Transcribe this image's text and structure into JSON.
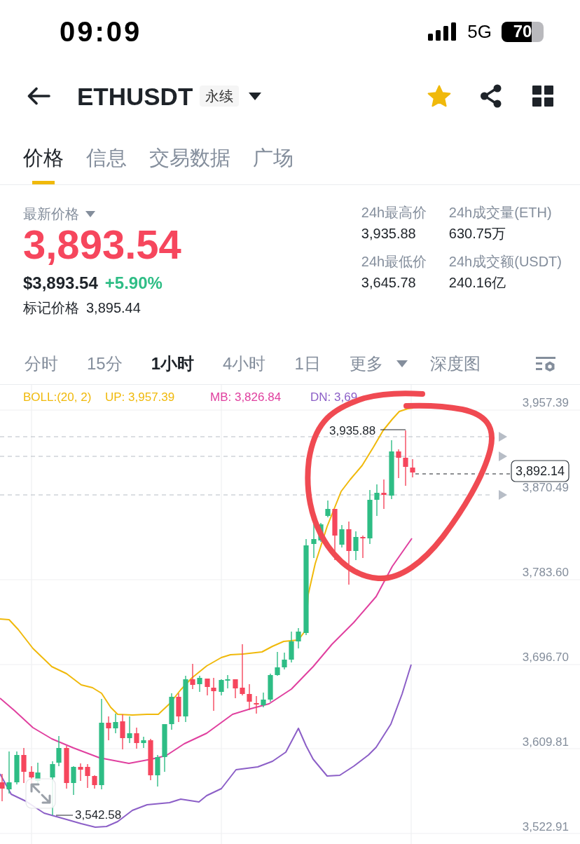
{
  "status_bar": {
    "time": "09:09",
    "network": "5G",
    "battery": "70"
  },
  "header": {
    "symbol": "ETHUSDT",
    "badge": "永续",
    "favorite": true
  },
  "tabs": [
    {
      "label": "价格",
      "selected": true
    },
    {
      "label": "信息",
      "selected": false
    },
    {
      "label": "交易数据",
      "selected": false
    },
    {
      "label": "广场",
      "selected": false
    }
  ],
  "price": {
    "label": "最新价格",
    "last": "3,893.54",
    "usd": "$3,893.54",
    "change": "+5.90%",
    "mark_label": "标记价格",
    "mark": "3,895.44"
  },
  "stats": [
    {
      "label": "24h最高价",
      "value": "3,935.88"
    },
    {
      "label": "24h成交量(ETH)",
      "value": "630.75万"
    },
    {
      "label": "24h最低价",
      "value": "3,645.78"
    },
    {
      "label": "24h成交额(USDT)",
      "value": "240.16亿"
    }
  ],
  "intervals": [
    {
      "label": "分时",
      "selected": false,
      "kind": "option"
    },
    {
      "label": "15分",
      "selected": false,
      "kind": "option"
    },
    {
      "label": "1小时",
      "selected": true,
      "kind": "option"
    },
    {
      "label": "4小时",
      "selected": false,
      "kind": "option"
    },
    {
      "label": "1日",
      "selected": false,
      "kind": "option"
    },
    {
      "label": "更多",
      "selected": false,
      "kind": "dropdown"
    },
    {
      "label": "深度图",
      "selected": false,
      "kind": "option"
    }
  ],
  "chart": {
    "indicator": "BOLL:(20, 2)",
    "bands": [
      {
        "label": "UP: 3,957.39",
        "color": "#f0b90b"
      },
      {
        "label": "MB: 3,826.84",
        "color": "#e0409f"
      },
      {
        "label": "DN: 3,69",
        "color": "#8c5fc7"
      }
    ],
    "y_axis": [
      "3,957.39",
      "3,870.49",
      "3,783.60",
      "3,696.70",
      "3,609.81",
      "3,522.91"
    ],
    "high_label": "3,935.88",
    "low_label": "3,542.58",
    "last_price": "3,892.14"
  }
}
